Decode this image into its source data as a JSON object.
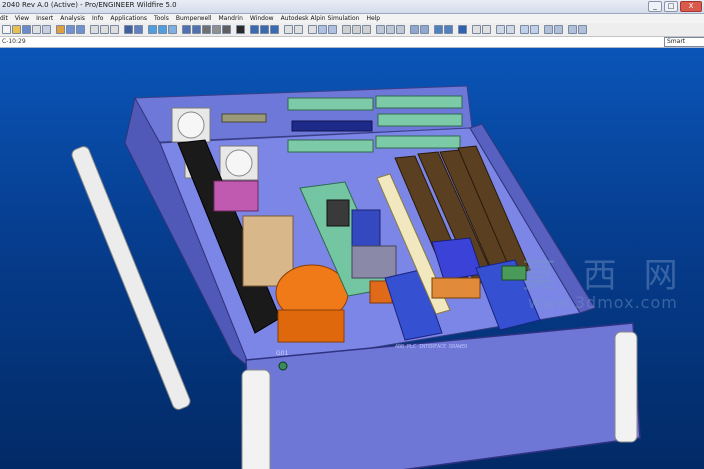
{
  "window": {
    "title": "2040 Rev A.0 (Active) - Pro/ENGINEER Wildfire 5.0",
    "buttons": {
      "minimize": "_",
      "maximize": "□",
      "close": "X"
    }
  },
  "menu": {
    "items": [
      "dit",
      "View",
      "Insert",
      "Analysis",
      "Info",
      "Applications",
      "Tools",
      "Bumperwell",
      "Mandrin",
      "Window",
      "Autodesk Alpin Simulation",
      "Help"
    ]
  },
  "status": {
    "coords": "C-10:29",
    "filter": "Smart"
  },
  "model": {
    "panel_label": "400 PLC INTERFACE DRAWER",
    "indicator_label": "G01"
  },
  "watermark": {
    "chinese": "莫 西 网",
    "url": "www.3dmox.com"
  },
  "colors": {
    "panel": "#6f78dc",
    "tray": "#8088e8",
    "connector": "#79c9a8",
    "ram": "#5a4020",
    "transformer": "#f07a18"
  }
}
